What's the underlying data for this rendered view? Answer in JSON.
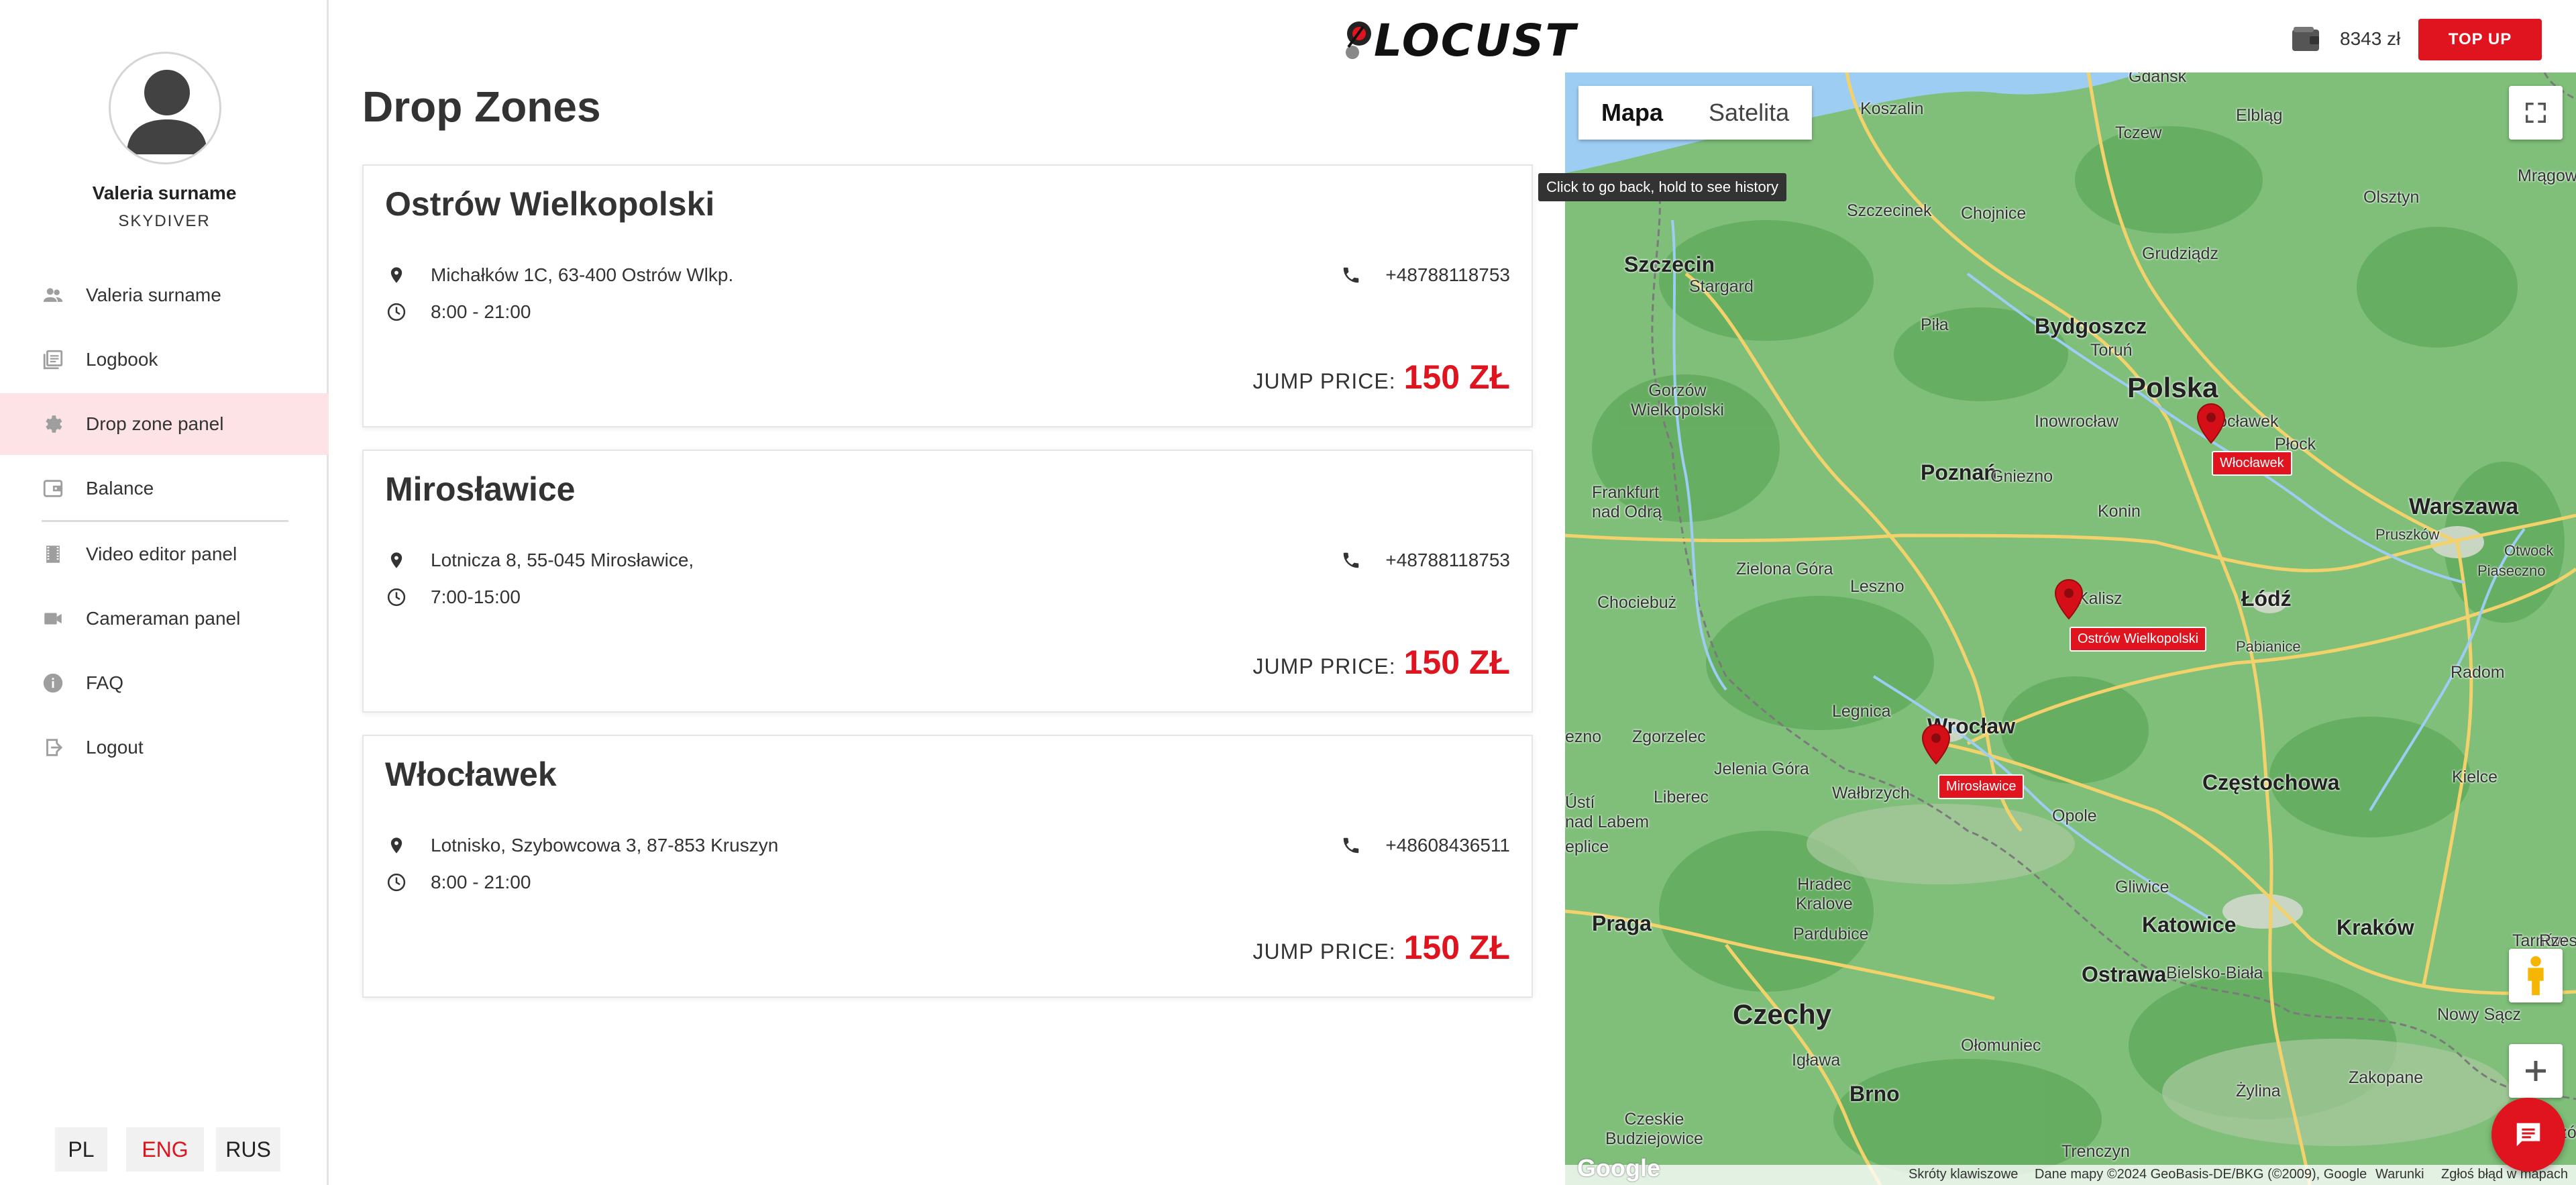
{
  "user": {
    "name": "Valeria surname",
    "role": "SKYDIVER"
  },
  "nav": {
    "items": [
      {
        "label": "Valeria surname",
        "icon": "people-icon"
      },
      {
        "label": "Logbook",
        "icon": "logbook-icon"
      },
      {
        "label": "Drop zone panel",
        "icon": "gear-icon",
        "active": true
      },
      {
        "label": "Balance",
        "icon": "wallet-icon"
      },
      {
        "label": "Video editor panel",
        "icon": "film-icon"
      },
      {
        "label": "Cameraman panel",
        "icon": "videocam-icon"
      },
      {
        "label": "FAQ",
        "icon": "info-icon"
      },
      {
        "label": "Logout",
        "icon": "logout-icon"
      }
    ]
  },
  "languages": [
    {
      "label": "PL"
    },
    {
      "label": "ENG",
      "active": true
    },
    {
      "label": "RUS"
    }
  ],
  "header": {
    "logo": "LOCUST",
    "balance": "8343 zł",
    "topup_label": "TOP UP"
  },
  "page": {
    "title": "Drop Zones"
  },
  "dropzones": [
    {
      "name": "Ostrów Wielkopolski",
      "address": "Michałków 1C, 63-400 Ostrów Wlkp.",
      "hours": "8:00 - 21:00",
      "phone": "+48788118753",
      "price_label": "JUMP PRICE:",
      "price": "150 ZŁ"
    },
    {
      "name": "Mirosławice",
      "address": "Lotnicza 8, 55-045 Mirosławice,",
      "hours": "7:00-15:00",
      "phone": "+48788118753",
      "price_label": "JUMP PRICE:",
      "price": "150 ZŁ"
    },
    {
      "name": "Włocławek",
      "address": "Lotnisko, Szybowcowa 3, 87-853 Kruszyn",
      "hours": "8:00 - 21:00",
      "phone": "+48608436511",
      "price_label": "JUMP PRICE:",
      "price": "150 ZŁ"
    }
  ],
  "map": {
    "type_buttons": [
      "Mapa",
      "Satelita"
    ],
    "tooltip": "Click to go back, hold to see history",
    "markers": [
      "Włocławek",
      "Ostrów Wielkopolski",
      "Mirosławice"
    ],
    "cities": {
      "gdansk": "Gdańsk",
      "koszalin": "Koszalin",
      "tczew": "Tczew",
      "elblag": "Elbląg",
      "mragowo": "Mrągowo",
      "szczecinek": "Szczecinek",
      "chojnice": "Chojnice",
      "grudziadz": "Grudziądz",
      "olsztyn": "Olsztyn",
      "szczecin": "Szczecin",
      "stargard": "Stargard",
      "bydgoszcz": "Bydgoszcz",
      "pila": "Piła",
      "torun": "Toruń",
      "gorzow": "Gorzów\nWielkopolski",
      "polska": "Polska",
      "inowroclaw": "Inowrocław",
      "wloclawek": "Włocławek",
      "plock": "Płock",
      "poznan": "Poznań",
      "gniezno": "Gniezno",
      "warszawa": "Warszawa",
      "frankfurt": "Frankfurt\nnad Odrą",
      "konin": "Konin",
      "pruszkow": "Pruszków",
      "otwock": "Otwock",
      "piaseczno": "Piaseczno",
      "zielona": "Zielona Góra",
      "leszno": "Leszno",
      "kalisz": "Kalisz",
      "lodz": "Łódź",
      "chociebuz": "Chociebuż",
      "pabianice": "Pabianice",
      "radom": "Radom",
      "legnica": "Legnica",
      "wroclaw": "Wrocław",
      "zgorzelec": "Zgorzelec",
      "jelenia": "Jelenia Góra",
      "walbrzych": "Wałbrzych",
      "liberec": "Liberec",
      "usti": "Ústí\nnad Labem",
      "czestochowa": "Częstochowa",
      "kielce": "Kielce",
      "opole": "Opole",
      "hradec": "Hradec\nKralove",
      "pardubice": "Pardubice",
      "gliwice": "Gliwice",
      "katowice": "Katowice",
      "krakow": "Kraków",
      "tarnow": "Tarnów",
      "praga": "Praga",
      "czechy": "Czechy",
      "ostrawa": "Ostrawa",
      "bielsko": "Bielsko-Biała",
      "nowysacz": "Nowy Sącz",
      "olomouc": "Ołomuniec",
      "jihlava": "Igława",
      "zylina": "Żylina",
      "zakopane": "Zakopane",
      "brno": "Brno",
      "budejovice": "Czeskie\nBudziejowice",
      "trencin": "Trenczyn",
      "presov": "Preszów",
      "ezno": "ezno",
      "eplice": "eplice",
      "rzes": "Rzes"
    },
    "footer": {
      "shortcuts": "Skróty klawiszowe",
      "mapdata": "Dane mapy ©2024 GeoBasis-DE/BKG (©2009), Google",
      "terms": "Warunki",
      "report": "Zgłoś błąd w mapach",
      "google": "Google"
    }
  },
  "colors": {
    "accent": "#e0141e",
    "active_nav_bg": "#fde3e5",
    "map_land": "#7fbf7a"
  }
}
